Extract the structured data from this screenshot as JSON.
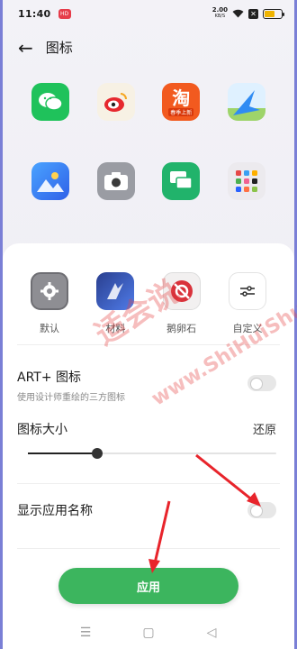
{
  "status": {
    "time": "11:40",
    "badge": "HD",
    "net_top": "2.00",
    "net_bottom": "KB/S",
    "battery_level": 0.6,
    "x_glyph": "✕"
  },
  "header": {
    "title": "图标",
    "back_glyph": "←"
  },
  "preview_icons": [
    {
      "name": "wechat-icon"
    },
    {
      "name": "weibo-icon"
    },
    {
      "name": "taobao-icon",
      "text": "淘",
      "sub": "春季上新"
    },
    {
      "name": "maps-icon"
    },
    {
      "name": "gallery-icon"
    },
    {
      "name": "camera-icon"
    },
    {
      "name": "messages-icon"
    },
    {
      "name": "app-folder-icon"
    }
  ],
  "styles": [
    {
      "label": "默认",
      "icon": "gear-icon"
    },
    {
      "label": "材料",
      "icon": "material-icon"
    },
    {
      "label": "鹅卵石",
      "icon": "pebble-icon"
    },
    {
      "label": "自定义",
      "icon": "sliders-icon"
    }
  ],
  "art_plus": {
    "title": "ART+ 图标",
    "subtitle": "使用设计师重绘的三方图标",
    "enabled": false
  },
  "icon_size": {
    "title": "图标大小",
    "reset_label": "还原",
    "level": 0.28
  },
  "show_name": {
    "title": "显示应用名称",
    "enabled": false
  },
  "apply_label": "应用",
  "nav": {
    "menu": "☰",
    "home": "▢",
    "back": "◁"
  },
  "watermark": {
    "cn": "适会说",
    "url": "www.ShiHuiShuo.Com"
  },
  "colors": {
    "accent": "#3cb55e",
    "frame": "#7a7fd6",
    "arrow": "#e8242b"
  }
}
